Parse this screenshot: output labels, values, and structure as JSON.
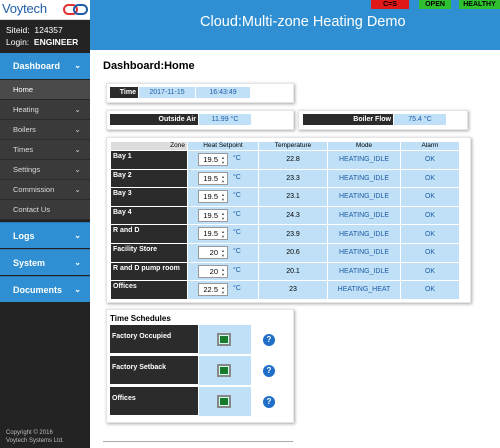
{
  "app": {
    "logo_text": "Voytech",
    "site_label": "Siteid:",
    "site_id": "124357",
    "login_label": "Login:",
    "login_user": "ENGINEER",
    "title": "Cloud:Multi-zone Heating Demo",
    "copyright_line1": "Copyright © 2016",
    "copyright_line2": "Voytech Systems Ltd."
  },
  "status": {
    "ces": "C=S",
    "open": "OPEN",
    "healthy": "HEALTHY",
    "colors": {
      "alarm": "#e01818",
      "ok": "#2fc02f"
    }
  },
  "sidebar": {
    "dashboard": "Dashboard",
    "sub_items": [
      {
        "label": "Home",
        "chevron": false
      },
      {
        "label": "Heating",
        "chevron": true
      },
      {
        "label": "Boilers",
        "chevron": true
      },
      {
        "label": "Times",
        "chevron": true
      },
      {
        "label": "Settings",
        "chevron": true
      },
      {
        "label": "Commission",
        "chevron": true
      },
      {
        "label": "Contact Us",
        "chevron": false
      }
    ],
    "main_items": [
      {
        "label": "Logs"
      },
      {
        "label": "System"
      },
      {
        "label": "Documents"
      }
    ]
  },
  "page": {
    "title": "Dashboard:Home",
    "time_label": "Time",
    "date": "2017-11-15",
    "time": "16:43:49",
    "outside_air_label": "Outside Air",
    "outside_air_value": "11.99 °C",
    "boiler_flow_label": "Boiler Flow",
    "boiler_flow_value": "75.4 °C"
  },
  "zones": {
    "headers": {
      "zone": "Zone",
      "setpoint": "Heat Setpoint",
      "temperature": "Temperature",
      "mode": "Mode",
      "alarm": "Alarm"
    },
    "unit": "°C",
    "rows": [
      {
        "name": "Bay 1",
        "setpoint": "19.5",
        "temperature": "22.8",
        "mode": "HEATING_IDLE",
        "alarm": "OK"
      },
      {
        "name": "Bay 2",
        "setpoint": "19.5",
        "temperature": "23.3",
        "mode": "HEATING_IDLE",
        "alarm": "OK"
      },
      {
        "name": "Bay 3",
        "setpoint": "19.5",
        "temperature": "23.1",
        "mode": "HEATING_IDLE",
        "alarm": "OK"
      },
      {
        "name": "Bay 4",
        "setpoint": "19.5",
        "temperature": "24.3",
        "mode": "HEATING_IDLE",
        "alarm": "OK"
      },
      {
        "name": "R and D",
        "setpoint": "19.5",
        "temperature": "23.9",
        "mode": "HEATING_IDLE",
        "alarm": "OK"
      },
      {
        "name": "Facility Store",
        "setpoint": "20",
        "temperature": "20.6",
        "mode": "HEATING_IDLE",
        "alarm": "OK"
      },
      {
        "name": "R and D pump room",
        "setpoint": "20",
        "temperature": "20.1",
        "mode": "HEATING_IDLE",
        "alarm": "OK"
      },
      {
        "name": "Offices",
        "setpoint": "22.5",
        "temperature": "23",
        "mode": "HEATING_HEAT",
        "alarm": "OK"
      }
    ]
  },
  "schedules": {
    "title": "Time Schedules",
    "items": [
      {
        "label": "Factory Occupied",
        "state": "on"
      },
      {
        "label": "Factory Setback",
        "state": "on"
      },
      {
        "label": "Offices",
        "state": "on"
      }
    ]
  }
}
